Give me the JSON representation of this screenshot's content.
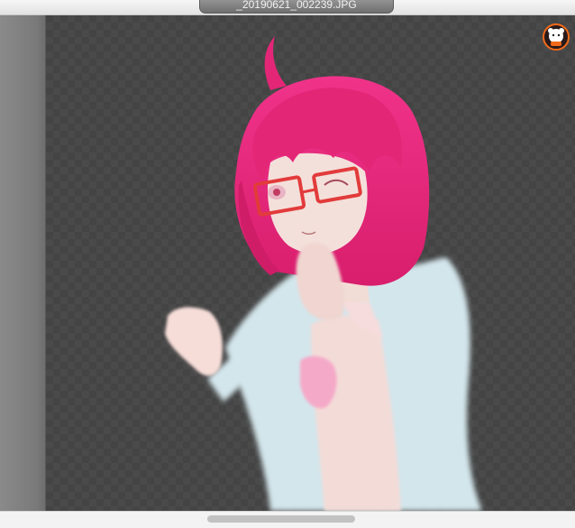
{
  "window": {
    "title": "_20190621_002239.JPG"
  },
  "viewer": {
    "image_description_icon": "anime-character-artwork",
    "badge_icon": "bear-mascot-icon"
  },
  "scrollbar": {
    "horizontal_position": 0.36
  }
}
